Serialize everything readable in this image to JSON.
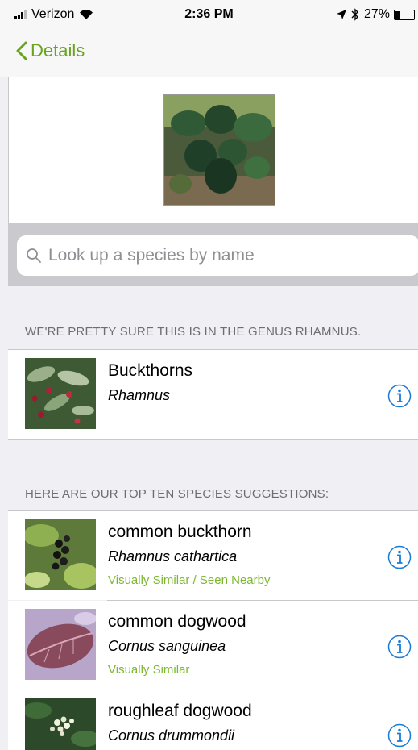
{
  "status_bar": {
    "carrier": "Verizon",
    "time": "2:36 PM",
    "battery": "27%",
    "battery_level": 0.27
  },
  "nav": {
    "back_label": "Details"
  },
  "search": {
    "placeholder": "Look up a species by name"
  },
  "genus_section": {
    "header": "WE'RE PRETTY SURE THIS IS IN THE GENUS RHAMNUS.",
    "item": {
      "name": "Buckthorns",
      "scientific": "Rhamnus"
    }
  },
  "species_section": {
    "header": "HERE ARE OUR TOP TEN SPECIES SUGGESTIONS:",
    "items": [
      {
        "name": "common buckthorn",
        "scientific": "Rhamnus cathartica",
        "tag": "Visually Similar / Seen Nearby"
      },
      {
        "name": "common dogwood",
        "scientific": "Cornus sanguinea",
        "tag": "Visually Similar"
      },
      {
        "name": "roughleaf dogwood",
        "scientific": "Cornus drummondii",
        "tag": ""
      }
    ]
  },
  "colors": {
    "accent_green": "#6aa322",
    "tag_green": "#7cb82f",
    "info_blue": "#1a7bd6"
  }
}
